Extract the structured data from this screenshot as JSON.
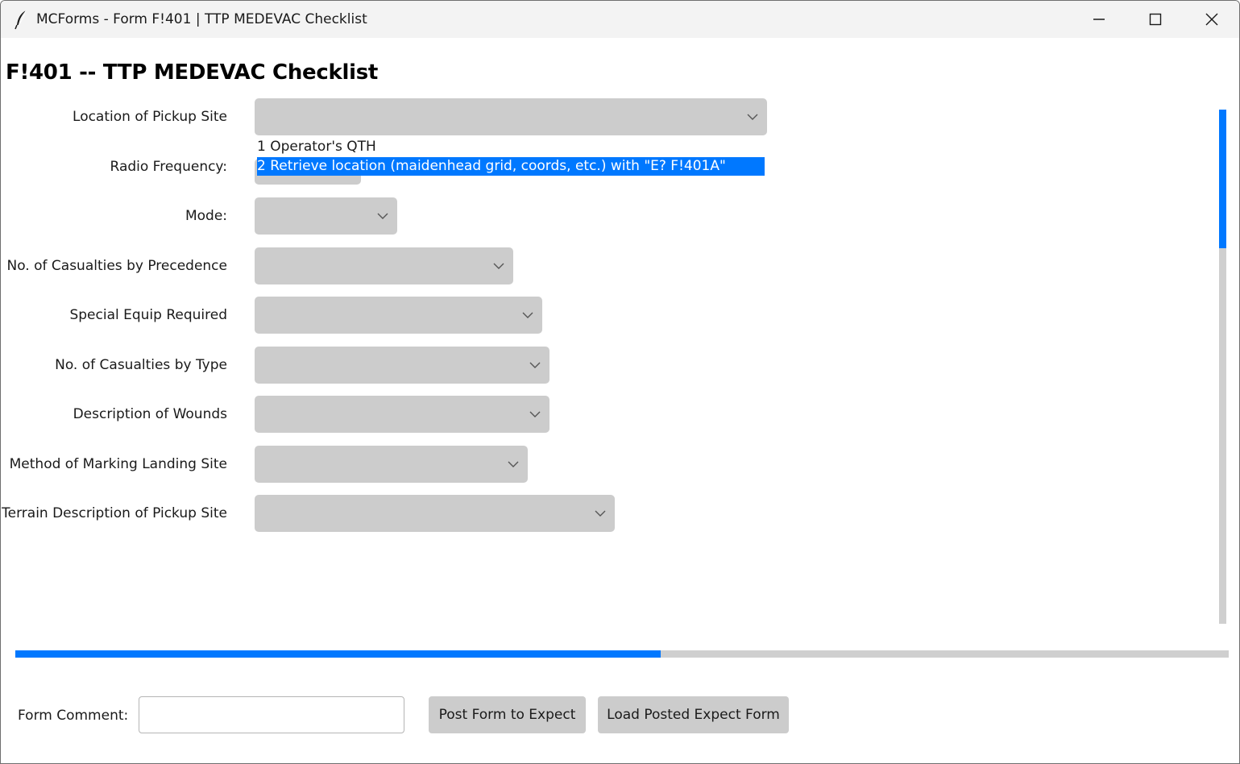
{
  "window": {
    "title": "MCForms - Form F!401 | TTP MEDEVAC Checklist"
  },
  "form": {
    "heading": "F!401 -- TTP MEDEVAC Checklist",
    "fields": [
      {
        "label": "Location of Pickup Site",
        "value": ""
      },
      {
        "label": "Radio Frequency:",
        "value": ""
      },
      {
        "label": "Mode:",
        "value": ""
      },
      {
        "label": "No. of Casualties by Precedence",
        "value": ""
      },
      {
        "label": "Special Equip Required",
        "value": ""
      },
      {
        "label": "No. of Casualties by Type",
        "value": ""
      },
      {
        "label": "Description of Wounds",
        "value": ""
      },
      {
        "label": "Method of Marking Landing Site",
        "value": ""
      },
      {
        "label": "Terrain Description of Pickup Site",
        "value": ""
      }
    ]
  },
  "dropdown": {
    "options": [
      "1 Operator's QTH",
      "2 Retrieve location (maidenhead grid, coords, etc.) with \"E? F!401A\""
    ],
    "selected_index": 1
  },
  "scrollbars": {
    "vertical_position_fraction": 0.0,
    "horizontal_position_fraction": 0.0
  },
  "footer": {
    "comment_label": "Form Comment:",
    "comment_value": "",
    "post_button": "Post Form to Expect",
    "load_button": "Load Posted Expect Form"
  },
  "colors": {
    "accent": "#0078ff",
    "combo_bg": "#cccccc",
    "titlebar_bg": "#f3f3f3"
  },
  "icons": {
    "app": "feather-icon",
    "minimize": "minimize-icon",
    "maximize": "maximize-icon",
    "close": "close-icon",
    "dropdown": "chevron-down-icon"
  }
}
